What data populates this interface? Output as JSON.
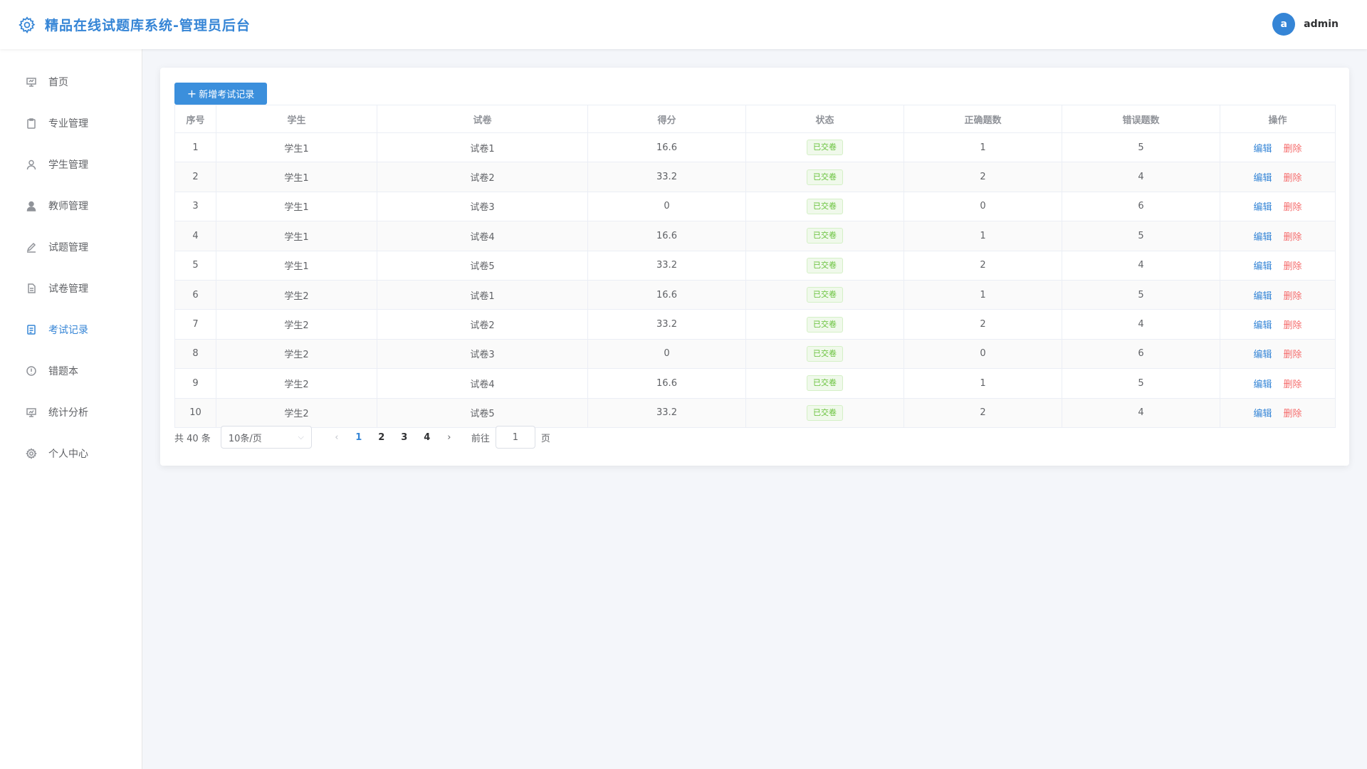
{
  "header": {
    "title": "精品在线试题库系统-管理员后台",
    "avatar_letter": "a",
    "username": "admin"
  },
  "sidebar": {
    "items": [
      {
        "label": "首页",
        "icon": "presentation-icon"
      },
      {
        "label": "专业管理",
        "icon": "clipboard-icon"
      },
      {
        "label": "学生管理",
        "icon": "user-icon"
      },
      {
        "label": "教师管理",
        "icon": "user-filled-icon"
      },
      {
        "label": "试题管理",
        "icon": "edit-pen-icon"
      },
      {
        "label": "试卷管理",
        "icon": "document-icon"
      },
      {
        "label": "考试记录",
        "icon": "tickets-icon",
        "active": true
      },
      {
        "label": "错题本",
        "icon": "warning-icon"
      },
      {
        "label": "统计分析",
        "icon": "chart-board-icon"
      },
      {
        "label": "个人中心",
        "icon": "setting-icon"
      }
    ]
  },
  "toolbar": {
    "add_label": "新增考试记录"
  },
  "table": {
    "headers": [
      "序号",
      "学生",
      "试卷",
      "得分",
      "状态",
      "正确题数",
      "错误题数",
      "操作"
    ],
    "edit_label": "编辑",
    "delete_label": "删除",
    "rows": [
      [
        "1",
        "学生1",
        "试卷1",
        "16.6",
        "已交卷",
        "1",
        "5"
      ],
      [
        "2",
        "学生1",
        "试卷2",
        "33.2",
        "已交卷",
        "2",
        "4"
      ],
      [
        "3",
        "学生1",
        "试卷3",
        "0",
        "已交卷",
        "0",
        "6"
      ],
      [
        "4",
        "学生1",
        "试卷4",
        "16.6",
        "已交卷",
        "1",
        "5"
      ],
      [
        "5",
        "学生1",
        "试卷5",
        "33.2",
        "已交卷",
        "2",
        "4"
      ],
      [
        "6",
        "学生2",
        "试卷1",
        "16.6",
        "已交卷",
        "1",
        "5"
      ],
      [
        "7",
        "学生2",
        "试卷2",
        "33.2",
        "已交卷",
        "2",
        "4"
      ],
      [
        "8",
        "学生2",
        "试卷3",
        "0",
        "已交卷",
        "0",
        "6"
      ],
      [
        "9",
        "学生2",
        "试卷4",
        "16.6",
        "已交卷",
        "1",
        "5"
      ],
      [
        "10",
        "学生2",
        "试卷5",
        "33.2",
        "已交卷",
        "2",
        "4"
      ]
    ]
  },
  "pagination": {
    "total_text": "共 40 条",
    "page_size": "10条/页",
    "pages": [
      "1",
      "2",
      "3",
      "4"
    ],
    "current_page": "1",
    "goto_label": "前往",
    "jump_value": "1",
    "page_suffix": "页"
  },
  "colors": {
    "accent": "#3585d6",
    "danger": "#f56c6c",
    "success": "#67c23a"
  }
}
